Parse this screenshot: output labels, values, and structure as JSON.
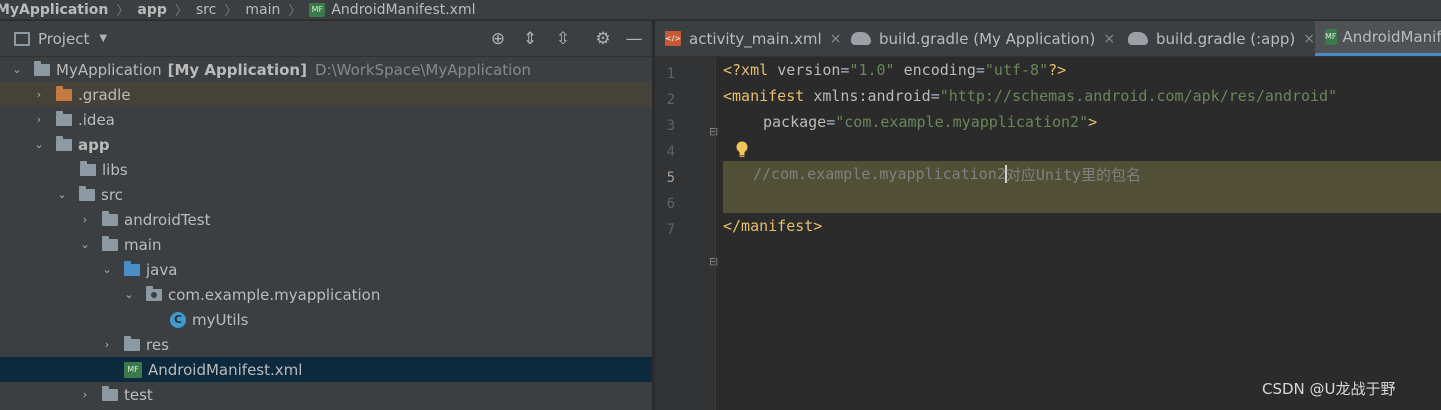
{
  "breadcrumb": {
    "items": [
      "MyApplication",
      "app",
      "src",
      "main",
      "AndroidManifest.xml"
    ]
  },
  "project_panel": {
    "title": "Project",
    "tree": [
      {
        "label": "MyApplication",
        "suffix": "[My Application]",
        "path": "D:\\WorkSpace\\MyApplication"
      },
      {
        "label": ".gradle"
      },
      {
        "label": ".idea"
      },
      {
        "label": "app"
      },
      {
        "label": "libs"
      },
      {
        "label": "src"
      },
      {
        "label": "androidTest"
      },
      {
        "label": "main"
      },
      {
        "label": "java"
      },
      {
        "label": "com.example.myapplication"
      },
      {
        "label": "myUtils"
      },
      {
        "label": "res"
      },
      {
        "label": "AndroidManifest.xml"
      },
      {
        "label": "test"
      }
    ]
  },
  "editor": {
    "tabs": [
      {
        "label": "activity_main.xml",
        "close": "×"
      },
      {
        "label": "build.gradle (My Application)",
        "close": "×"
      },
      {
        "label": "build.gradle (:app)",
        "close": "×"
      },
      {
        "label": "AndroidManifest.xml"
      }
    ],
    "line_numbers": [
      "1",
      "2",
      "3",
      "4",
      "5",
      "6",
      "7"
    ],
    "code": {
      "l1": {
        "open": "<?xml ",
        "attr1": "version",
        "eq1": "=",
        "val1": "\"1.0\"",
        "attr2": " encoding",
        "eq2": "=",
        "val2": "\"utf-8\"",
        "close": "?>"
      },
      "l2": {
        "tag": "<manifest ",
        "attr": "xmlns:android",
        "eq": "=",
        "val": "\"http://schemas.android.com/apk/res/android\""
      },
      "l3": {
        "attr": "package",
        "eq": "=",
        "val": "\"com.example.myapplication2\"",
        "close": ">"
      },
      "l5": {
        "comment_a": "//com.example.myapplication2",
        "comment_b": "对应Unity里的包名"
      },
      "l7": {
        "tag": "</manifest>"
      }
    }
  },
  "watermark": "CSDN @U龙战于野",
  "colors": {
    "accent": "#4a88c7",
    "selection": "#0d293e",
    "line_highlight": "#515036"
  }
}
